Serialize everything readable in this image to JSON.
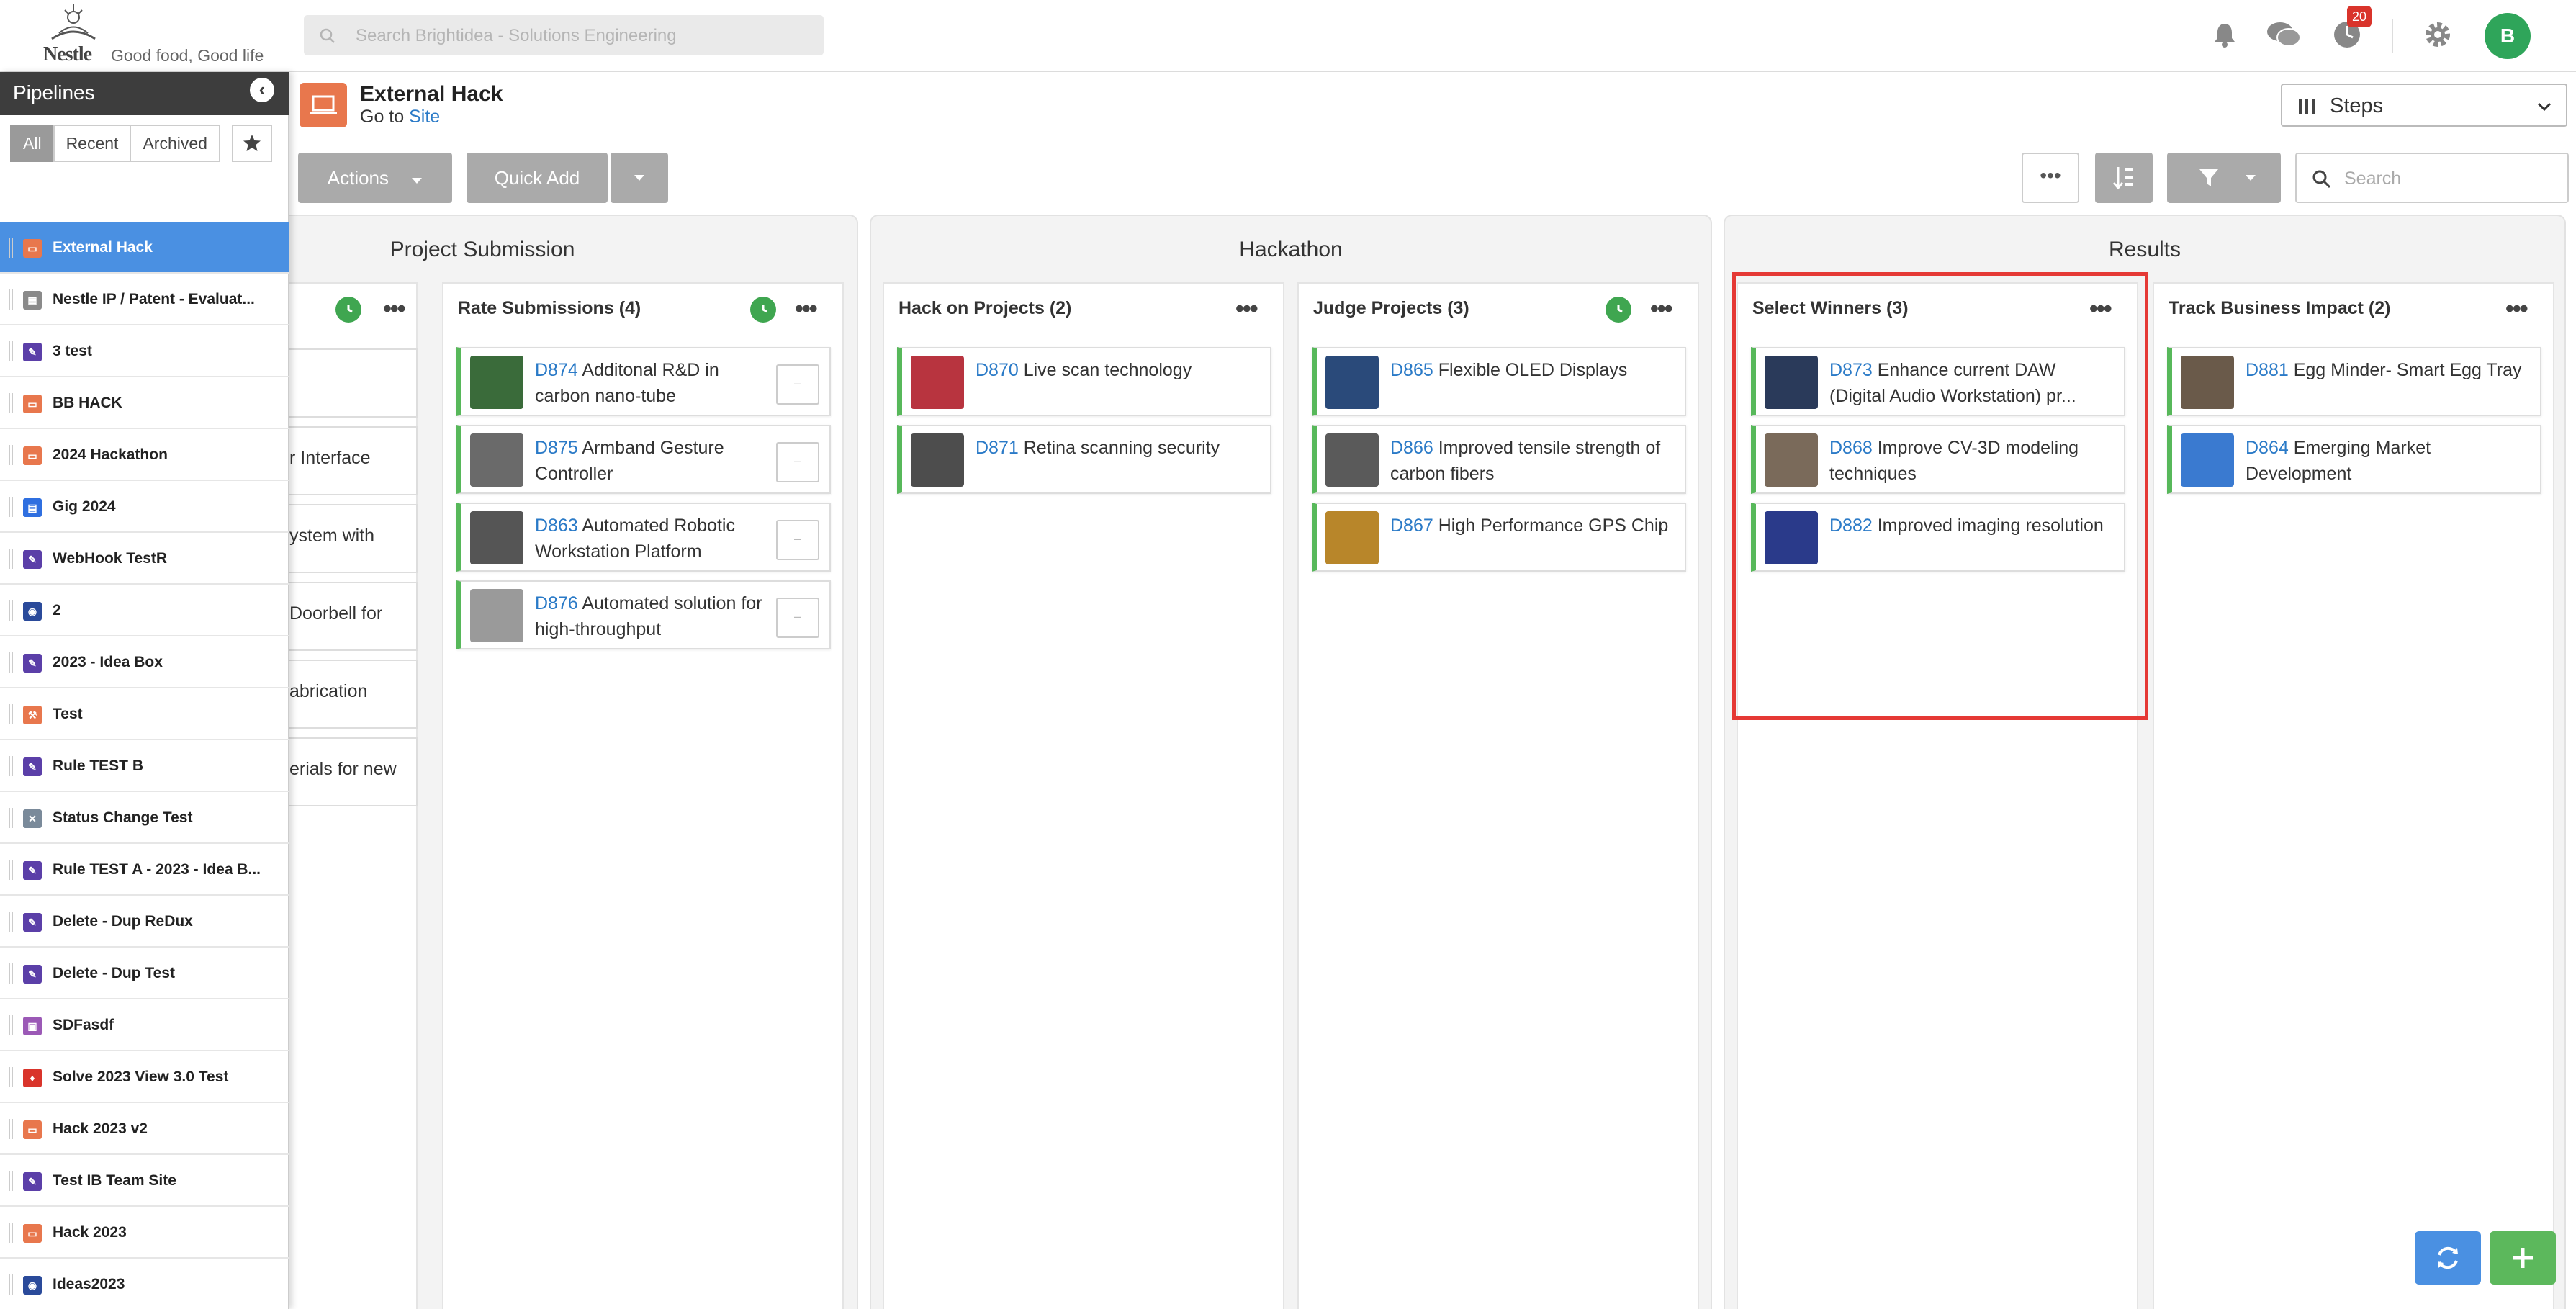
{
  "header": {
    "brand": "Nestle",
    "tagline": "Good food, Good life",
    "search_placeholder": "Search Brightidea - Solutions Engineering",
    "notification_count": "20",
    "avatar_initial": "B"
  },
  "sidebar": {
    "title": "Pipelines",
    "tabs": [
      {
        "label": "All",
        "active": true
      },
      {
        "label": "Recent",
        "active": false
      },
      {
        "label": "Archived",
        "active": false
      }
    ],
    "items": [
      {
        "label": "External Hack",
        "icon": "laptop-icon",
        "color": "#e8774d",
        "active": true
      },
      {
        "label": "Nestle IP / Patent - Evaluat...",
        "icon": "pattern-icon",
        "color": "#8a8a8a",
        "active": false
      },
      {
        "label": "3 test",
        "icon": "idea-box-icon",
        "color": "#5b3fa8",
        "active": false
      },
      {
        "label": "BB HACK",
        "icon": "laptop-icon",
        "color": "#e8774d",
        "active": false
      },
      {
        "label": "2024 Hackathon",
        "icon": "laptop-icon",
        "color": "#e8774d",
        "active": false
      },
      {
        "label": "Gig 2024",
        "icon": "calendar-icon",
        "color": "#2f6fe0",
        "active": false
      },
      {
        "label": "WebHook TestR",
        "icon": "idea-box-icon",
        "color": "#5b3fa8",
        "active": false
      },
      {
        "label": "2",
        "icon": "globe-icon",
        "color": "#2a4a9a",
        "active": false
      },
      {
        "label": "2023 - Idea Box",
        "icon": "idea-box-icon",
        "color": "#5b3fa8",
        "active": false
      },
      {
        "label": "Test",
        "icon": "hammer-icon",
        "color": "#e8774d",
        "active": false
      },
      {
        "label": "Rule TEST B",
        "icon": "idea-box-icon",
        "color": "#5b3fa8",
        "active": false
      },
      {
        "label": "Status Change Test",
        "icon": "tools-icon",
        "color": "#7a8a9a",
        "active": false
      },
      {
        "label": "Rule TEST A - 2023 - Idea B...",
        "icon": "idea-box-icon",
        "color": "#5b3fa8",
        "active": false
      },
      {
        "label": "Delete - Dup ReDux",
        "icon": "idea-box-icon",
        "color": "#5b3fa8",
        "active": false
      },
      {
        "label": "Delete - Dup Test",
        "icon": "idea-box-icon",
        "color": "#5b3fa8",
        "active": false
      },
      {
        "label": "SDFasdf",
        "icon": "image-icon",
        "color": "#9b59b6",
        "active": false
      },
      {
        "label": "Solve 2023 View 3.0 Test",
        "icon": "flame-icon",
        "color": "#d9342b",
        "active": false
      },
      {
        "label": "Hack 2023 v2",
        "icon": "laptop-icon",
        "color": "#e8774d",
        "active": false
      },
      {
        "label": "Test IB Team Site",
        "icon": "idea-box-icon",
        "color": "#5b3fa8",
        "active": false
      },
      {
        "label": "Hack 2023",
        "icon": "laptop-icon",
        "color": "#e8774d",
        "active": false
      },
      {
        "label": "Ideas2023",
        "icon": "globe-icon",
        "color": "#2a4a9a",
        "active": false
      }
    ]
  },
  "project": {
    "title": "External Hack",
    "goto_prefix": "Go to",
    "goto_link": "Site",
    "view_select": "Steps"
  },
  "toolbar": {
    "actions_label": "Actions",
    "quick_add_label": "Quick Add",
    "more_label": "•••",
    "search_placeholder": "Search"
  },
  "groups": [
    {
      "title": "Project Submission"
    },
    {
      "title": "Hackathon"
    },
    {
      "title": "Results"
    }
  ],
  "partial_column": {
    "fragments": [
      "",
      "r Interface",
      "ystem with",
      "Doorbell for",
      "abrication",
      "erials for new"
    ]
  },
  "columns": [
    {
      "title": "Rate Submissions",
      "count": "(4)",
      "clock": true,
      "cards": [
        {
          "id": "D874",
          "text": "Additonal R&D in carbon nano-tube",
          "img": "#3a6b3a",
          "check": true
        },
        {
          "id": "D875",
          "text": "Armband Gesture Controller",
          "img": "#6a6a6a",
          "check": true
        },
        {
          "id": "D863",
          "text": "Automated Robotic Workstation Platform",
          "img": "#555555",
          "check": true
        },
        {
          "id": "D876",
          "text": "Automated solution for high-throughput",
          "img": "#9a9a9a",
          "check": true
        }
      ]
    },
    {
      "title": "Hack on Projects",
      "count": "(2)",
      "clock": false,
      "cards": [
        {
          "id": "D870",
          "text": "Live scan technology",
          "img": "#b8343f",
          "check": false
        },
        {
          "id": "D871",
          "text": "Retina scanning security",
          "img": "#4d4d4d",
          "check": false
        }
      ]
    },
    {
      "title": "Judge Projects",
      "count": "(3)",
      "clock": true,
      "cards": [
        {
          "id": "D865",
          "text": "Flexible OLED Displays",
          "img": "#2a4a7a",
          "check": false
        },
        {
          "id": "D866",
          "text": "Improved tensile strength of carbon fibers",
          "img": "#5a5a5a",
          "check": false
        },
        {
          "id": "D867",
          "text": "High Performance GPS Chip",
          "img": "#b8862a",
          "check": false
        }
      ]
    },
    {
      "title": "Select Winners",
      "count": "(3)",
      "clock": false,
      "cards": [
        {
          "id": "D873",
          "text": "Enhance current DAW (Digital Audio Workstation) pr...",
          "img": "#2a3a5a",
          "check": false
        },
        {
          "id": "D868",
          "text": "Improve CV-3D modeling techniques",
          "img": "#7a6a5a",
          "check": false
        },
        {
          "id": "D882",
          "text": "Improved imaging resolution",
          "img": "#2a3a8a",
          "check": false
        }
      ]
    },
    {
      "title": "Track Business Impact",
      "count": "(2)",
      "clock": false,
      "cards": [
        {
          "id": "D881",
          "text": "Egg Minder- Smart Egg Tray",
          "img": "#6a5a4a",
          "check": false
        },
        {
          "id": "D864",
          "text": "Emerging Market Development",
          "img": "#3a7ad0",
          "check": false
        }
      ]
    }
  ],
  "colors": {
    "accent": "#4a90e2",
    "link": "#2a7ac7",
    "card_stripe": "#57b85a",
    "highlight": "#e53935",
    "fab_refresh": "#4a90e2",
    "fab_add": "#5cb85c"
  }
}
